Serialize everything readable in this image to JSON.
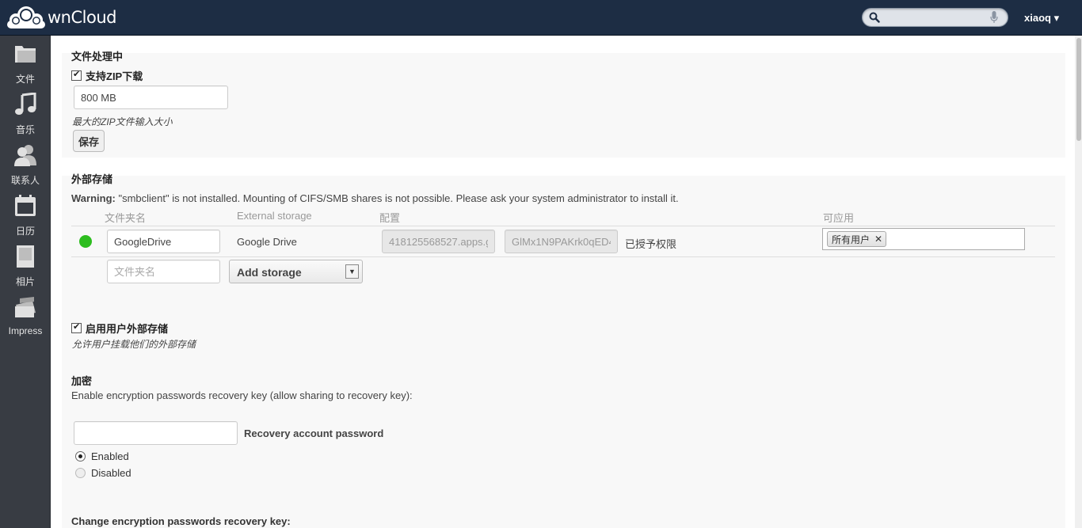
{
  "app": {
    "name": "ownCloud",
    "logo_text": "wnCloud"
  },
  "header": {
    "search_placeholder": "",
    "user": "xiaoq ▾"
  },
  "nav": [
    {
      "label": "文件",
      "icon": "folder-icon"
    },
    {
      "label": "音乐",
      "icon": "music-icon"
    },
    {
      "label": "联系人",
      "icon": "contacts-icon"
    },
    {
      "label": "日历",
      "icon": "calendar-icon"
    },
    {
      "label": "相片",
      "icon": "photos-icon"
    },
    {
      "label": "Impress",
      "icon": "impress-icon"
    }
  ],
  "file_handling": {
    "title": "文件处理中",
    "zip_checkbox_label": "支持ZIP下载",
    "zip_checked": true,
    "max_zip_value": "800 MB",
    "max_zip_hint": "最大的ZIP文件输入大小",
    "save_label": "保存"
  },
  "external_storage": {
    "title": "外部存储",
    "warning_bold": "Warning:",
    "warning_text": " \"smbclient\" is not installed. Mounting of CIFS/SMB shares is not possible. Please ask your system administrator to install it.",
    "columns": {
      "folder": "文件夹名",
      "backend": "External storage",
      "config": "配置",
      "applicable": "可应用"
    },
    "row": {
      "folder": "GoogleDrive",
      "backend": "Google Drive",
      "client_id": "418125568527.apps.g",
      "client_secret": "GlMx1N9PAKrk0qED4",
      "status": "已授予权限",
      "applicable_chip": "所有用户",
      "status_color": "#2dbd1f"
    },
    "new_folder_placeholder": "文件夹名",
    "add_storage_label": "Add storage",
    "user_mount_label": "启用用户外部存储",
    "user_mount_checked": true,
    "user_mount_hint": "允许用户挂载他们的外部存储"
  },
  "encryption": {
    "title": "加密",
    "recovery_desc": "Enable encryption passwords recovery key (allow sharing to recovery key):",
    "password_value": "",
    "password_label": "Recovery account password",
    "enabled_label": "Enabled",
    "disabled_label": "Disabled",
    "change_title": "Change encryption passwords recovery key:"
  }
}
